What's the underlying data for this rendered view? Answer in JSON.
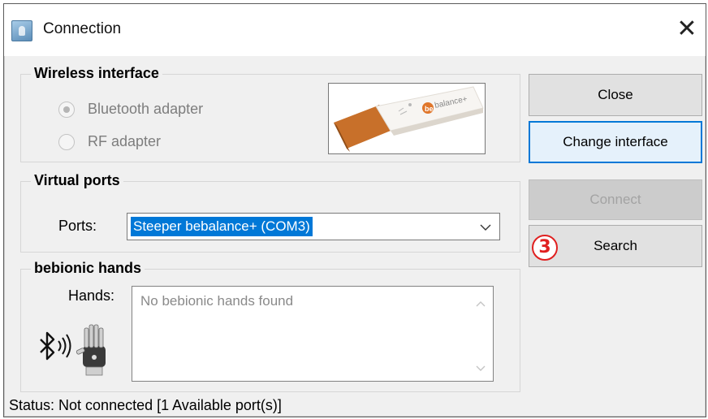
{
  "window": {
    "title": "Connection",
    "close_glyph": "✕"
  },
  "wireless": {
    "group_title": "Wireless interface",
    "options": [
      {
        "label": "Bluetooth adapter",
        "checked": true,
        "enabled": false
      },
      {
        "label": "RF adapter",
        "checked": false,
        "enabled": false
      }
    ],
    "dongle_brand": "bebalance+"
  },
  "virtual_ports": {
    "group_title": "Virtual ports",
    "ports_label": "Ports:",
    "selected_port": "Steeper bebalance+ (COM3)"
  },
  "hands": {
    "group_title": "bebionic hands",
    "hands_label": "Hands:",
    "list_placeholder": "No bebionic hands found"
  },
  "buttons": {
    "close": "Close",
    "change_interface": "Change interface",
    "connect": "Connect",
    "search": "Search"
  },
  "annotation": {
    "badge": "3",
    "color": "#e02020"
  },
  "status": {
    "text": "Status: Not connected [1 Available port(s)]"
  },
  "colors": {
    "accent": "#0078d7",
    "dongle_orange": "#c8702a"
  },
  "icons": [
    "app-icon",
    "close-icon",
    "usb-dongle-image",
    "bluetooth-icon",
    "robotic-hand-icon",
    "chevron-down-icon",
    "scroll-up-icon",
    "scroll-down-icon"
  ]
}
